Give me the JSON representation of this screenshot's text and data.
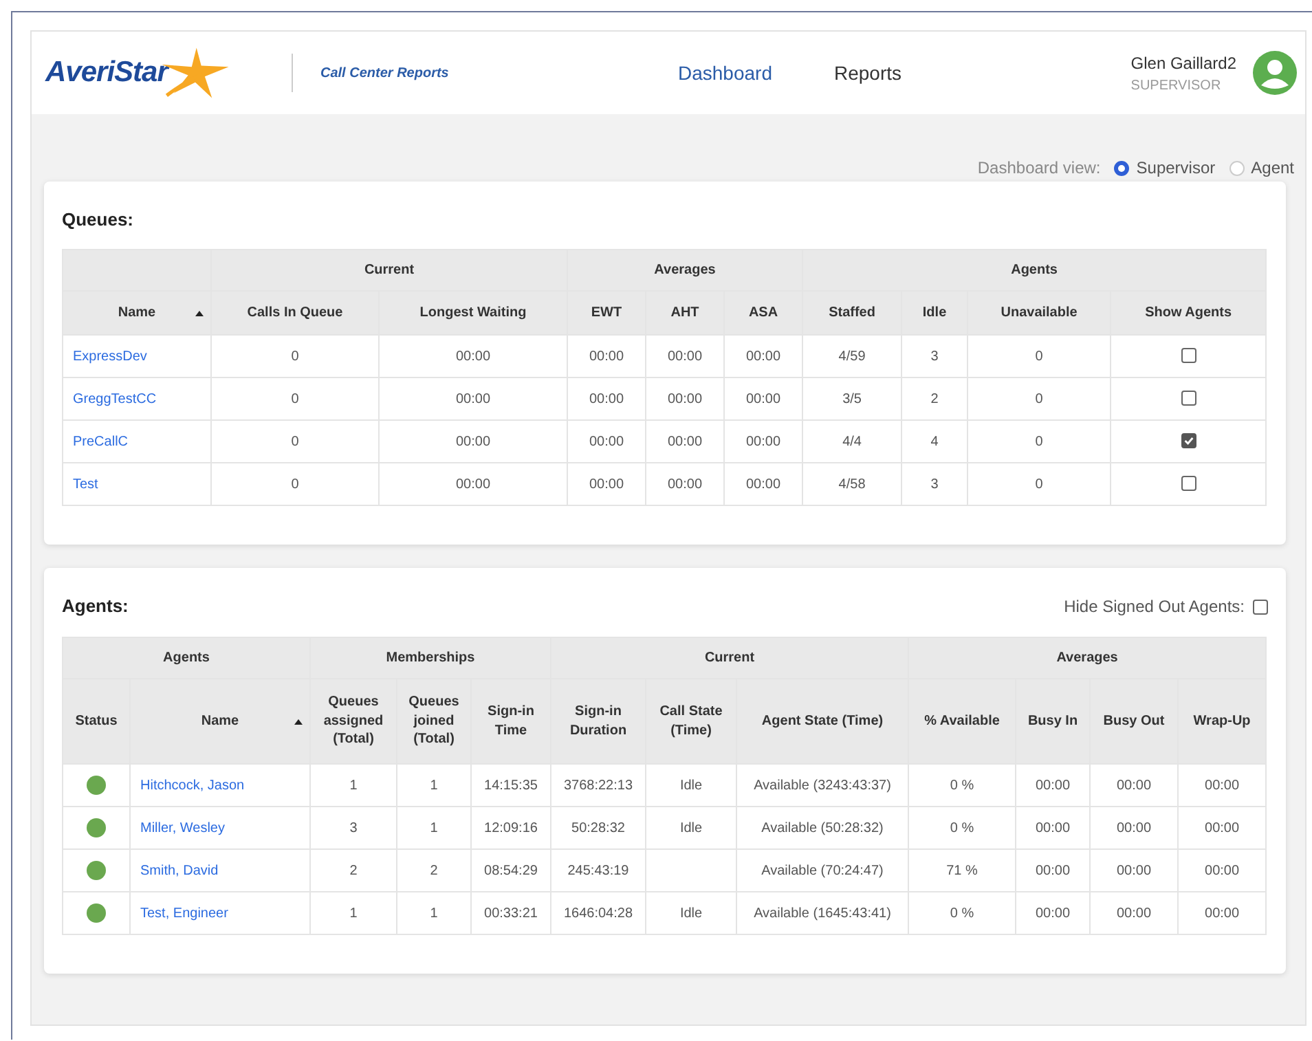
{
  "header": {
    "logo_text": "AveriStar",
    "app_title": "Call Center Reports",
    "nav": [
      {
        "label": "Dashboard",
        "selected": true
      },
      {
        "label": "Reports",
        "selected": false
      }
    ],
    "user": {
      "name": "Glen Gaillard2",
      "role": "SUPERVISOR"
    }
  },
  "view_selector": {
    "label": "Dashboard view:",
    "options": [
      {
        "label": "Supervisor",
        "selected": true
      },
      {
        "label": "Agent",
        "selected": false
      }
    ]
  },
  "queues": {
    "title": "Queues:",
    "groups": [
      {
        "columns": [
          {
            "label": "Name",
            "sorted": true
          }
        ]
      },
      {
        "label": "Current",
        "columns": [
          {
            "label": "Calls In Queue",
            "sorted": false
          },
          {
            "label": "Longest Waiting",
            "sorted": false
          }
        ]
      },
      {
        "label": "Averages",
        "columns": [
          {
            "label": "EWT",
            "sorted": false
          },
          {
            "label": "AHT",
            "sorted": false
          },
          {
            "label": "ASA",
            "sorted": false
          }
        ]
      },
      {
        "label": "Agents",
        "columns": [
          {
            "label": "Staffed",
            "sorted": false
          },
          {
            "label": "Idle",
            "sorted": false
          },
          {
            "label": "Unavailable",
            "sorted": false
          },
          {
            "label": "Show Agents",
            "sorted": false
          }
        ]
      }
    ],
    "rows": [
      {
        "name": "ExpressDev",
        "cells": [
          "0",
          "00:00",
          "00:00",
          "00:00",
          "00:00",
          "4/59",
          "3",
          "0"
        ],
        "show_agents": false
      },
      {
        "name": "GreggTestCC",
        "cells": [
          "0",
          "00:00",
          "00:00",
          "00:00",
          "00:00",
          "3/5",
          "2",
          "0"
        ],
        "show_agents": false
      },
      {
        "name": "PreCallC",
        "cells": [
          "0",
          "00:00",
          "00:00",
          "00:00",
          "00:00",
          "4/4",
          "4",
          "0"
        ],
        "show_agents": true
      },
      {
        "name": "Test",
        "cells": [
          "0",
          "00:00",
          "00:00",
          "00:00",
          "00:00",
          "4/58",
          "3",
          "0"
        ],
        "show_agents": false
      }
    ]
  },
  "agents": {
    "title": "Agents:",
    "hide_signed_out": {
      "label": "Hide Signed Out Agents:",
      "checked": false
    },
    "groups": [
      {
        "label": "Agents",
        "columns": [
          {
            "label": "Status",
            "sorted": false
          },
          {
            "label": "Name",
            "sorted": true
          }
        ]
      },
      {
        "label": "Memberships",
        "columns": [
          {
            "label": "Queues assigned (Total)",
            "sorted": false
          },
          {
            "label": "Queues joined (Total)",
            "sorted": false
          },
          {
            "label": "Sign-in Time",
            "sorted": false
          }
        ]
      },
      {
        "label": "Current",
        "columns": [
          {
            "label": "Sign-in Duration",
            "sorted": false
          },
          {
            "label": "Call State (Time)",
            "sorted": false
          },
          {
            "label": "Agent State (Time)",
            "sorted": false
          }
        ]
      },
      {
        "label": "Averages",
        "columns": [
          {
            "label": "% Available",
            "sorted": false
          },
          {
            "label": "Busy In",
            "sorted": false
          },
          {
            "label": "Busy Out",
            "sorted": false
          },
          {
            "label": "Wrap-Up",
            "sorted": false
          }
        ]
      }
    ],
    "rows": [
      {
        "color": "#6aa84f",
        "name": "Hitchcock, Jason",
        "cells": [
          "1",
          "1",
          "14:15:35",
          "3768:22:13",
          "Idle",
          "Available (3243:43:37)",
          "0 %",
          "00:00",
          "00:00",
          "00:00"
        ]
      },
      {
        "color": "#6aa84f",
        "name": "Miller, Wesley",
        "cells": [
          "3",
          "1",
          "12:09:16",
          "50:28:32",
          "Idle",
          "Available (50:28:32)",
          "0 %",
          "00:00",
          "00:00",
          "00:00"
        ]
      },
      {
        "color": "#6aa84f",
        "name": "Smith, David",
        "cells": [
          "2",
          "2",
          "08:54:29",
          "245:43:19",
          null,
          "Available (70:24:47)",
          "71 %",
          "00:00",
          "00:00",
          "00:00"
        ]
      },
      {
        "color": "#6aa84f",
        "name": "Test, Engineer",
        "cells": [
          "1",
          "1",
          "00:33:21",
          "1646:04:28",
          "Idle",
          "Available (1645:43:41)",
          "0 %",
          "00:00",
          "00:00",
          "00:00"
        ]
      }
    ]
  }
}
